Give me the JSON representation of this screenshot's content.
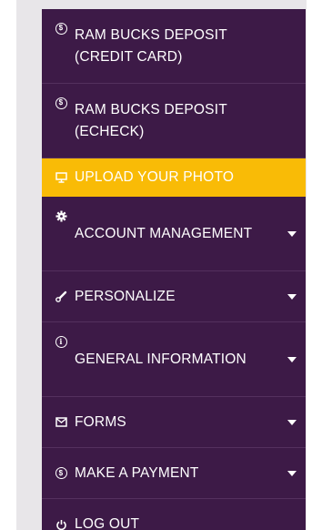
{
  "menu": {
    "items": [
      {
        "label": "RAM BUCKS DEPOSIT (CREDIT CARD)",
        "icon": "dollar-coin-icon",
        "has_caret": false
      },
      {
        "label": "RAM BUCKS DEPOSIT (ECHECK)",
        "icon": "dollar-coin-icon",
        "has_caret": false
      },
      {
        "label": "UPLOAD YOUR PHOTO",
        "icon": "monitor-icon",
        "has_caret": false,
        "active": true
      },
      {
        "label": "ACCOUNT MANAGEMENT",
        "icon": "gear-icon",
        "has_caret": true
      },
      {
        "label": "PERSONALIZE",
        "icon": "brush-icon",
        "has_caret": true
      },
      {
        "label": "GENERAL INFORMATION",
        "icon": "info-icon",
        "has_caret": true
      },
      {
        "label": "FORMS",
        "icon": "envelope-icon",
        "has_caret": true
      },
      {
        "label": "MAKE A PAYMENT",
        "icon": "dollar-coin-icon",
        "has_caret": true
      },
      {
        "label": "LOG OUT",
        "icon": "power-icon",
        "has_caret": false
      }
    ]
  },
  "colors": {
    "menu_bg": "#3d1a47",
    "active_bg": "#f9bb06",
    "text": "#ffffff"
  }
}
